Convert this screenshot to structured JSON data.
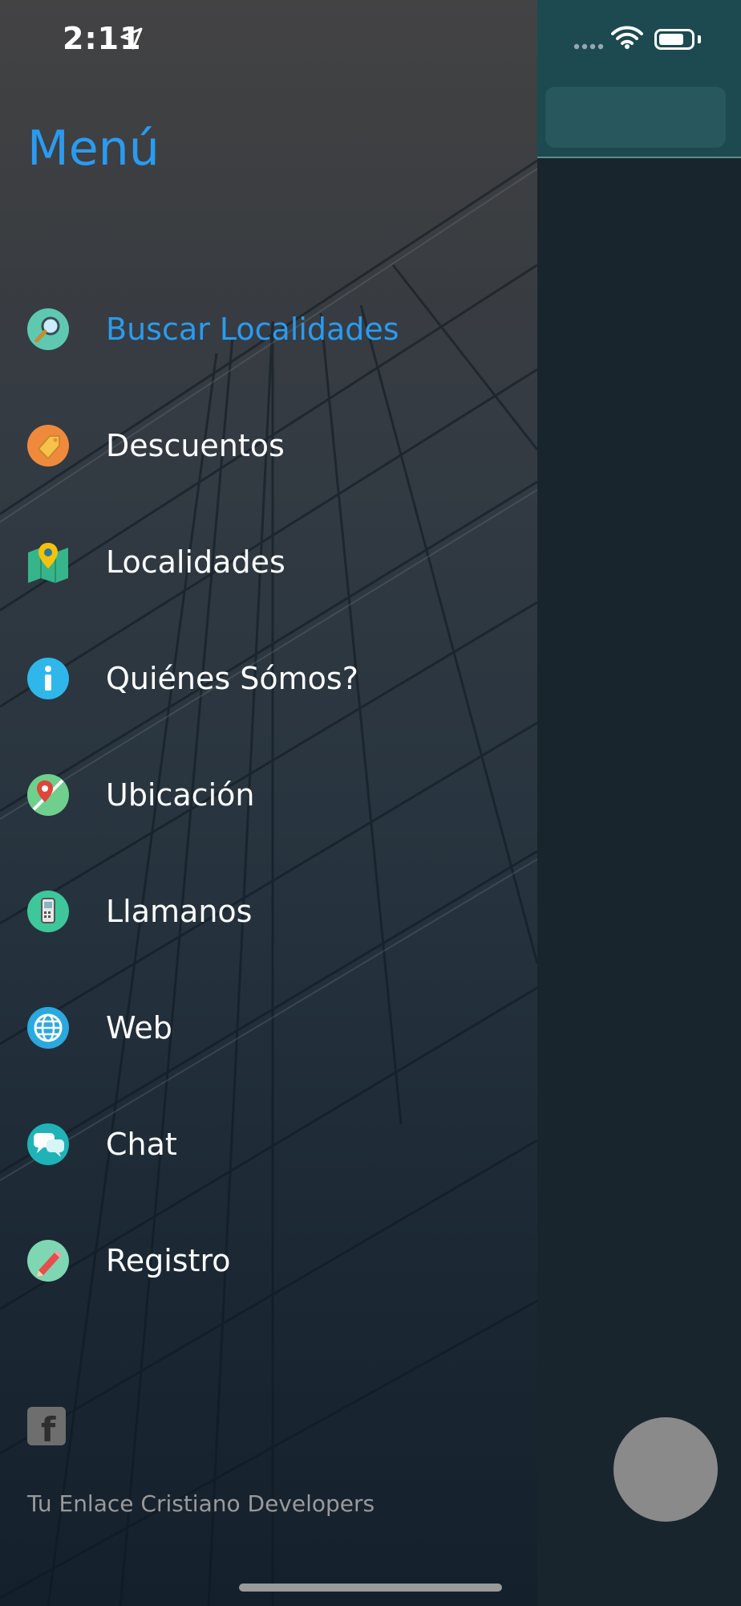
{
  "status_bar": {
    "time": "2:11"
  },
  "drawer": {
    "title": "Menú",
    "items": [
      {
        "label": "Buscar Localidades",
        "icon": "magnifier-icon",
        "active": true
      },
      {
        "label": "Descuentos",
        "icon": "price-tag-icon"
      },
      {
        "label": "Localidades",
        "icon": "map-pin-icon"
      },
      {
        "label": "Quiénes Sómos?",
        "icon": "info-icon"
      },
      {
        "label": "Ubicación",
        "icon": "location-icon"
      },
      {
        "label": "Llamanos",
        "icon": "phone-icon"
      },
      {
        "label": "Web",
        "icon": "globe-icon"
      },
      {
        "label": "Chat",
        "icon": "chat-icon"
      },
      {
        "label": "Registro",
        "icon": "pencil-icon"
      }
    ],
    "footer": "Tu Enlace Cristiano Developers",
    "social": {
      "facebook_letter": "f"
    }
  },
  "colors": {
    "accent": "#2a9bf0",
    "text": "#ffffff",
    "footer_text": "#9a9a9a"
  }
}
